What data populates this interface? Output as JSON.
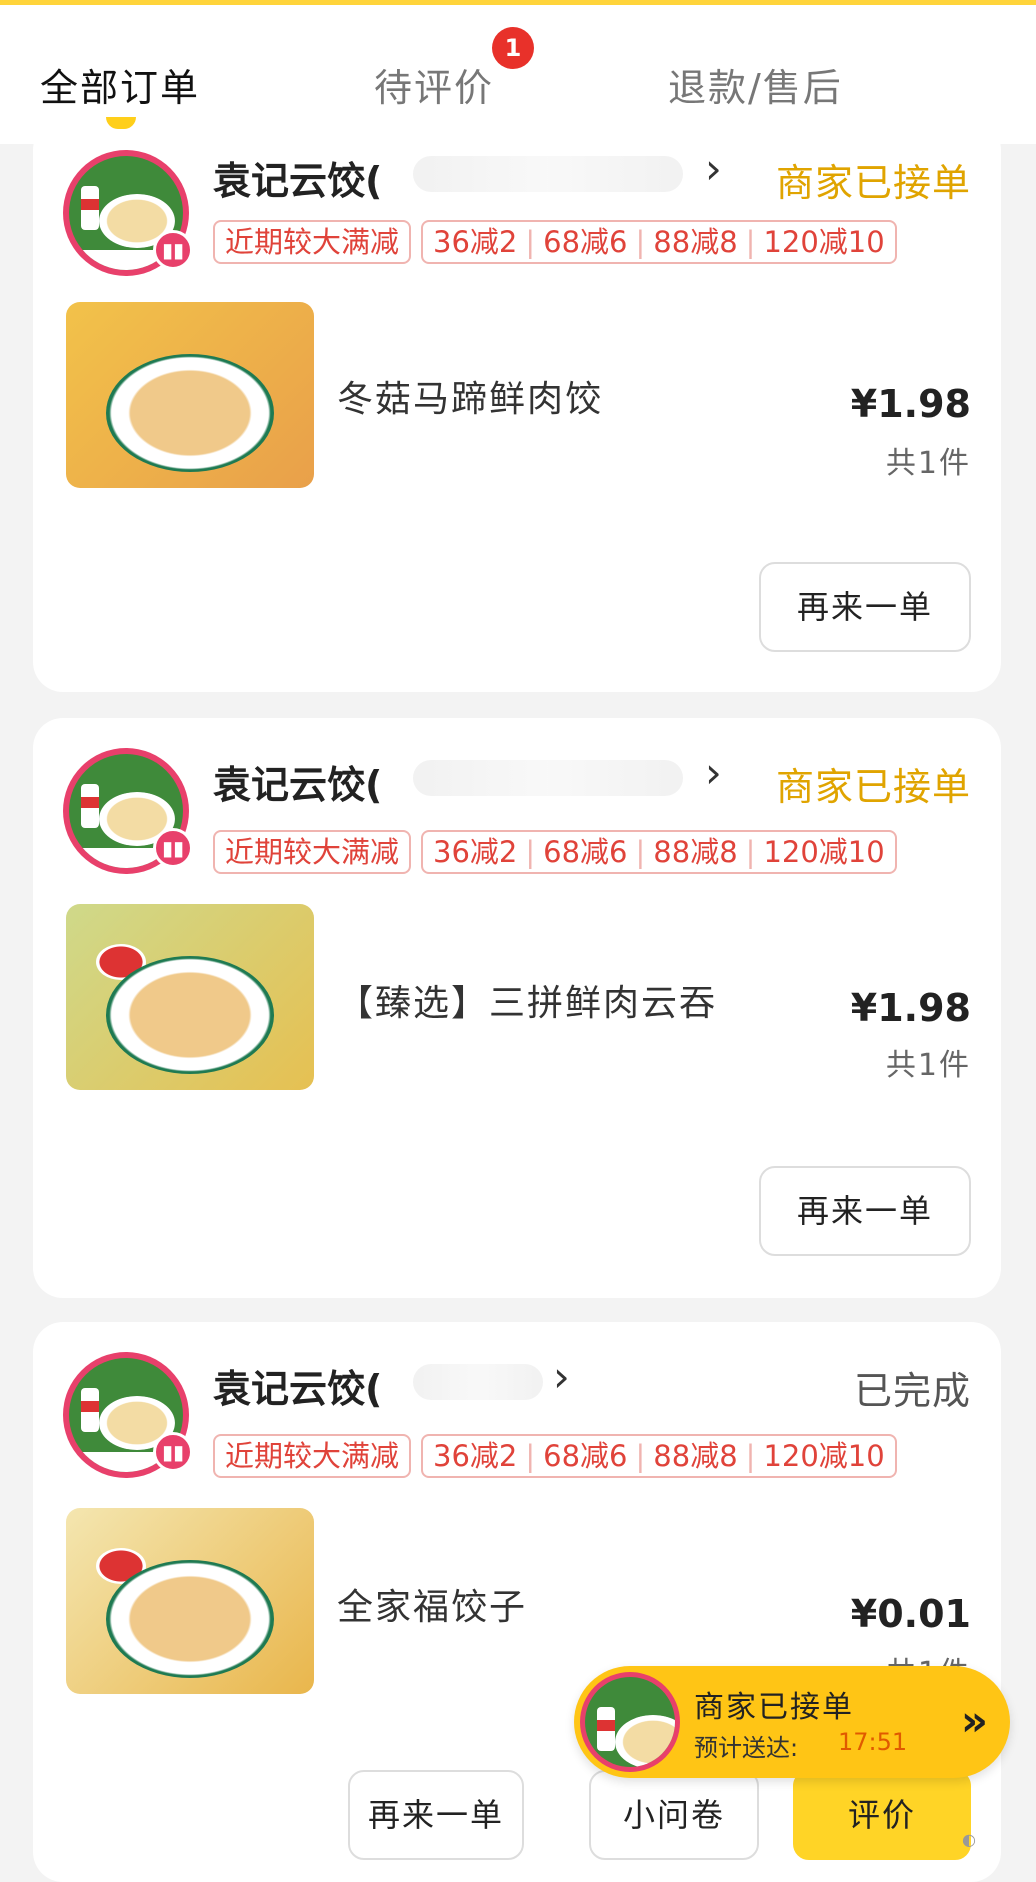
{
  "tabs": [
    {
      "label": "全部订单",
      "active": true
    },
    {
      "label": "待评价",
      "badge": "1"
    },
    {
      "label": "退款/售后"
    }
  ],
  "orders": [
    {
      "store": "袁记云饺(",
      "status": "商家已接单",
      "promo_label": "近期较大满减",
      "promos": [
        "36减2",
        "68减6",
        "88减8",
        "120减10"
      ],
      "item": "冬菇马蹄鲜肉饺",
      "price": "¥1.98",
      "qty": "共1件",
      "buttons": [
        "再来一单"
      ]
    },
    {
      "store": "袁记云饺(",
      "status": "商家已接单",
      "promo_label": "近期较大满减",
      "promos": [
        "36减2",
        "68减6",
        "88减8",
        "120减10"
      ],
      "item": "【臻选】三拼鲜肉云吞",
      "price": "¥1.98",
      "qty": "共1件",
      "buttons": [
        "再来一单"
      ]
    },
    {
      "store": "袁记云饺(",
      "status": "已完成",
      "promo_label": "近期较大满减",
      "promos": [
        "36减2",
        "68减6",
        "88减8",
        "120减10"
      ],
      "item": "全家福饺子",
      "price": "¥0.01",
      "qty": "共1件",
      "buttons": [
        "再来一单",
        "小问卷",
        "评价"
      ]
    }
  ],
  "floating_status": {
    "title": "商家已接单",
    "eta_label": "预计送达:",
    "eta_time": "17:51"
  },
  "colors": {
    "accent_yellow": "#ffd426",
    "status_pending": "#e0a400",
    "promo_red": "#e0433a",
    "badge_red": "#e8312a"
  },
  "icons": [
    "chevron-right-icon",
    "store-logo",
    "double-chevron-icon"
  ]
}
